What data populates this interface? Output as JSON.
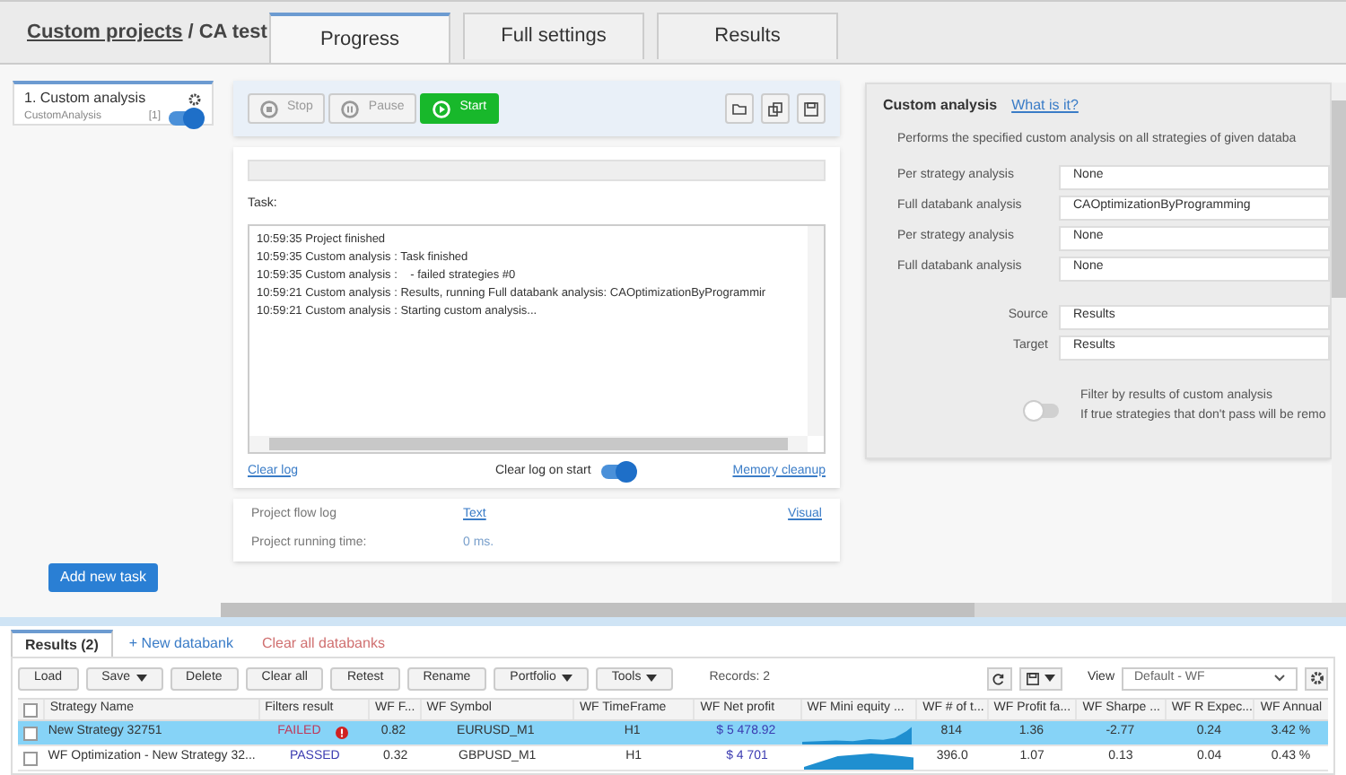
{
  "breadcrumb": {
    "parent": "Custom projects",
    "separator": "/",
    "current": "CA test"
  },
  "tabs": [
    {
      "label": "Progress",
      "selected": true
    },
    {
      "label": "Full settings",
      "selected": false
    },
    {
      "label": "Results",
      "selected": false
    }
  ],
  "tasks": [
    {
      "title": "1. Custom analysis",
      "type": "CustomAnalysis",
      "count": "[1]",
      "on": true,
      "selected": true
    }
  ],
  "add_task": "Add new task",
  "toolbar": {
    "buttons": [
      {
        "label": "Stop",
        "kind": "stop",
        "disabled": true
      },
      {
        "label": "Pause",
        "kind": "pause",
        "disabled": true
      },
      {
        "label": "Start",
        "kind": "start",
        "disabled": false
      }
    ]
  },
  "log": {
    "progress": {
      "level": 0
    },
    "task_label": "Task:",
    "lines": [
      "10:59:35 Project finished",
      "10:59:35 Custom analysis : Task finished",
      "10:59:35 Custom analysis :    - failed strategies #0",
      "10:59:21 Custom analysis : Results, running Full databank analysis: CAOptimizationByProgrammir",
      "10:59:21 Custom analysis : Starting custom analysis..."
    ],
    "clear_log": "Clear log",
    "clear_on_start": {
      "label": "Clear log on start",
      "on": true
    },
    "memory_cleanup": "Memory cleanup"
  },
  "flow": {
    "label": "Project flow log",
    "text_link": "Text",
    "visual_link": "Visual",
    "time_label": "Project running time:",
    "time_value": "0 ms."
  },
  "settings": {
    "title": "Custom analysis",
    "help_link": "What is it?",
    "description": "Performs the specified custom analysis on all strategies of given databa",
    "fields": [
      {
        "label": "Per strategy analysis",
        "value": "None"
      },
      {
        "label": "Full databank analysis",
        "value": "CAOptimizationByProgramming"
      },
      {
        "label": "Per strategy analysis",
        "value": "None"
      },
      {
        "label": "Full databank analysis",
        "value": "None"
      }
    ],
    "source": {
      "label": "Source",
      "value": "Results"
    },
    "target": {
      "label": "Target",
      "value": "Results"
    },
    "filter": {
      "on": false,
      "label": "Filter by results of custom analysis",
      "hint": "If true strategies that don't pass will be remo"
    }
  },
  "results_tabs": [
    {
      "label": "Results (2)",
      "kind": "tab",
      "selected": true
    },
    {
      "label": "+ New databank",
      "kind": "add",
      "selected": false
    },
    {
      "label": "Clear all databanks",
      "kind": "clear",
      "selected": false
    }
  ],
  "results_toolbar": {
    "buttons": [
      {
        "label": "Load",
        "dropdown": false
      },
      {
        "label": "Save",
        "dropdown": true
      },
      {
        "label": "Delete",
        "dropdown": false
      },
      {
        "label": "Clear all",
        "dropdown": false
      },
      {
        "label": "Retest",
        "dropdown": false
      },
      {
        "label": "Rename",
        "dropdown": false
      },
      {
        "label": "Portfolio",
        "dropdown": true
      },
      {
        "label": "Tools",
        "dropdown": true
      }
    ],
    "records": "Records: 2",
    "view_label": "View",
    "view_value": "Default - WF"
  },
  "table": {
    "all_checked": false,
    "columns": [
      "Strategy Name",
      "Filters result",
      "WF F...",
      "WF Symbol",
      "WF TimeFrame",
      "WF Net profit",
      "WF Mini equity ...",
      "WF # of t...",
      "WF Profit fa...",
      "WF Sharpe ...",
      "WF R Expec...",
      "WF Annual"
    ],
    "rows": [
      {
        "selected": true,
        "checked": false,
        "name": "New Strategy 32751",
        "filter": "FAILED",
        "kind": "failed",
        "wf_f": "0.82",
        "symbol": "EURUSD_M1",
        "timeframe": "H1",
        "net_profit": "$ 5 478.92",
        "trades": "814",
        "profit_factor": "1.36",
        "sharpe": "-2.77",
        "r_expectancy": "0.24",
        "annual": "3.42 %"
      },
      {
        "selected": false,
        "checked": false,
        "name": "WF Optimization - New Strategy 32...",
        "filter": "PASSED",
        "kind": "passed",
        "wf_f": "0.32",
        "symbol": "GBPUSD_M1",
        "timeframe": "H1",
        "net_profit": "$ 4 701",
        "trades": "396.0",
        "profit_factor": "1.07",
        "sharpe": "0.13",
        "r_expectancy": "0.04",
        "annual": "0.43 %"
      }
    ]
  }
}
